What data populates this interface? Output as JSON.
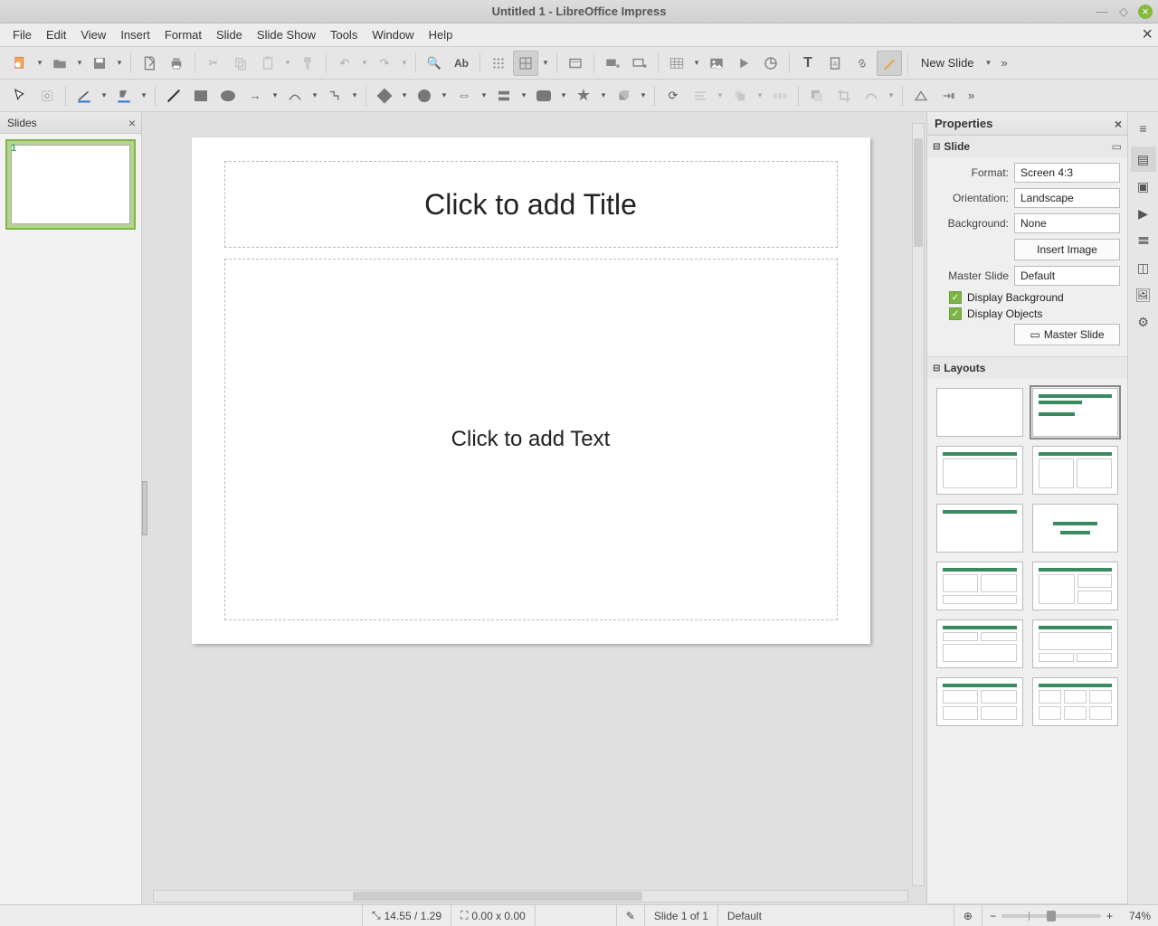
{
  "window": {
    "title": "Untitled 1 - LibreOffice Impress"
  },
  "menu": {
    "items": [
      "File",
      "Edit",
      "View",
      "Insert",
      "Format",
      "Slide",
      "Slide Show",
      "Tools",
      "Window",
      "Help"
    ]
  },
  "toolbar": {
    "newslide": "New Slide"
  },
  "slides_panel": {
    "title": "Slides",
    "thumbs": [
      {
        "num": "1"
      }
    ]
  },
  "canvas": {
    "title_placeholder": "Click to add Title",
    "content_placeholder": "Click to add Text"
  },
  "properties": {
    "title": "Properties",
    "slide_section": "Slide",
    "format_label": "Format:",
    "format_value": "Screen 4:3",
    "orientation_label": "Orientation:",
    "orientation_value": "Landscape",
    "background_label": "Background:",
    "background_value": "None",
    "insert_image": "Insert Image",
    "master_label": "Master Slide",
    "master_value": "Default",
    "chk_display_bg": "Display Background",
    "chk_display_obj": "Display Objects",
    "master_btn": "Master Slide",
    "layouts_section": "Layouts"
  },
  "status": {
    "cursor": "14.55 / 1.29",
    "size": "0.00 x 0.00",
    "slide": "Slide 1 of 1",
    "master": "Default",
    "zoom": "74%"
  }
}
